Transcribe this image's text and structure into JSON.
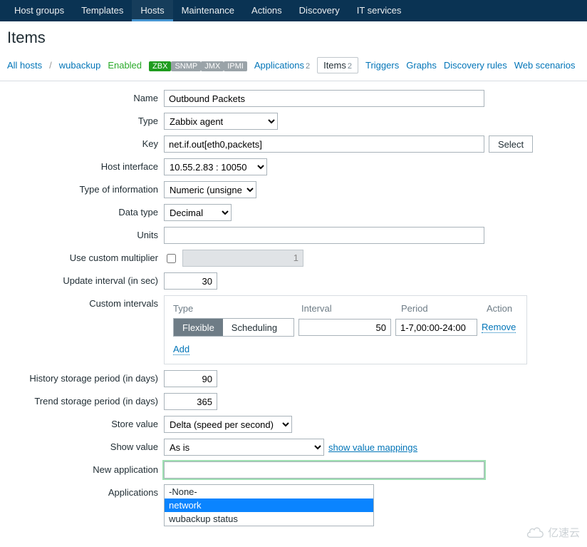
{
  "topnav": {
    "items": [
      "Host groups",
      "Templates",
      "Hosts",
      "Maintenance",
      "Actions",
      "Discovery",
      "IT services"
    ],
    "active_index": 2
  },
  "page_title": "Items",
  "subnav": {
    "all_hosts": "All hosts",
    "host": "wubackup",
    "status": "Enabled",
    "availability": [
      {
        "label": "ZBX",
        "state": "green"
      },
      {
        "label": "SNMP",
        "state": "grey"
      },
      {
        "label": "JMX",
        "state": "grey"
      },
      {
        "label": "IPMI",
        "state": "grey"
      }
    ],
    "applications": {
      "label": "Applications",
      "count": "2"
    },
    "items": {
      "label": "Items",
      "count": "2"
    },
    "triggers": "Triggers",
    "graphs": "Graphs",
    "discovery_rules": "Discovery rules",
    "web_scenarios": "Web scenarios"
  },
  "form": {
    "name": {
      "label": "Name",
      "value": "Outbound Packets"
    },
    "type": {
      "label": "Type",
      "value": "Zabbix agent"
    },
    "key": {
      "label": "Key",
      "value": "net.if.out[eth0,packets]",
      "select_btn": "Select"
    },
    "host_interface": {
      "label": "Host interface",
      "value": "10.55.2.83 : 10050"
    },
    "type_of_info": {
      "label": "Type of information",
      "value": "Numeric (unsigned)"
    },
    "data_type": {
      "label": "Data type",
      "value": "Decimal"
    },
    "units": {
      "label": "Units",
      "value": ""
    },
    "use_multiplier": {
      "label": "Use custom multiplier",
      "checked": false,
      "value": "1"
    },
    "update_interval": {
      "label": "Update interval (in sec)",
      "value": "30"
    },
    "custom_intervals": {
      "label": "Custom intervals",
      "headers": {
        "type": "Type",
        "interval": "Interval",
        "period": "Period",
        "action": "Action"
      },
      "seg": {
        "flexible": "Flexible",
        "scheduling": "Scheduling",
        "active": "flexible"
      },
      "interval_value": "50",
      "period_value": "1-7,00:00-24:00",
      "remove": "Remove",
      "add": "Add"
    },
    "history": {
      "label": "History storage period (in days)",
      "value": "90"
    },
    "trend": {
      "label": "Trend storage period (in days)",
      "value": "365"
    },
    "store_value": {
      "label": "Store value",
      "value": "Delta (speed per second)"
    },
    "show_value": {
      "label": "Show value",
      "value": "As is",
      "mappings": "show value mappings"
    },
    "new_application": {
      "label": "New application",
      "value": ""
    },
    "applications": {
      "label": "Applications",
      "options": [
        {
          "label": "-None-",
          "selected": false
        },
        {
          "label": "network",
          "selected": true
        },
        {
          "label": "wubackup status",
          "selected": false
        }
      ]
    }
  },
  "watermark": "亿速云"
}
